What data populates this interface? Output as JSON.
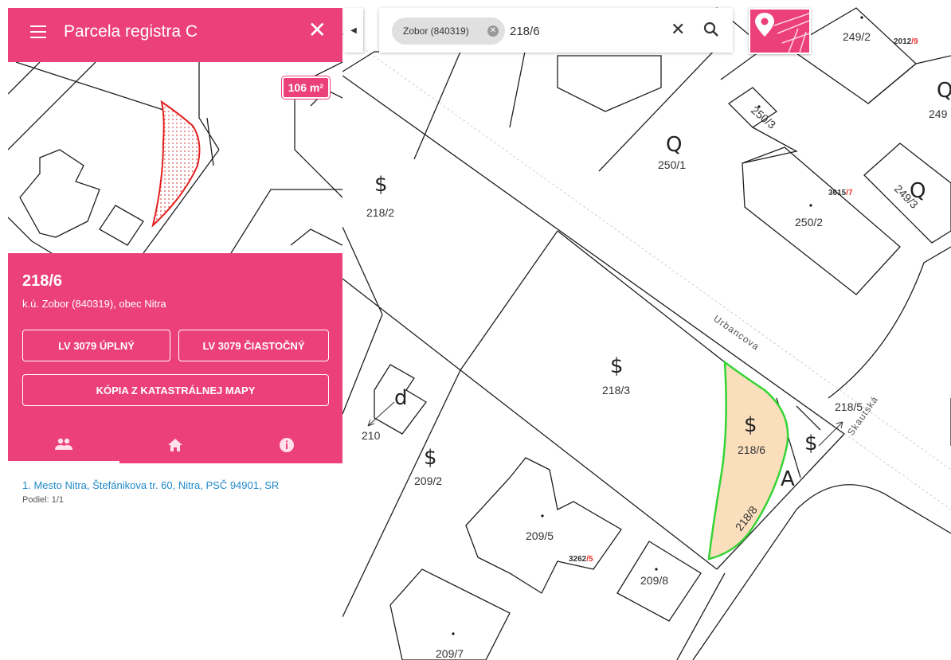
{
  "panel": {
    "title": "Parcela registra C",
    "area_badge": "106 m²",
    "parcel_number": "218/6",
    "location": "k.ú. Zobor (840319), obec Nitra",
    "buttons": {
      "lv_full": "LV 3079 ÚPLNÝ",
      "lv_partial": "LV 3079 ČIASTOČNÝ",
      "copy_map": "KÓPIA Z KATASTRÁLNEJ MAPY"
    },
    "tabs": [
      "owners-icon",
      "house-icon",
      "info-icon"
    ],
    "owner": "1. Mesto Nitra, Štefánikova tr. 60, Nitra, PSČ 94901, SR",
    "share": "Podiel: 1/1"
  },
  "search": {
    "chip_label": "Zobor (840319)",
    "query": "218/6"
  },
  "map": {
    "parcels": [
      "249/2",
      "249",
      "250/3",
      "250/1",
      "250/2",
      "249/3",
      "218/2",
      "218/3",
      "218/6",
      "218/8",
      "218/5",
      "209/2",
      "209/5",
      "209/8",
      "209/7",
      "210"
    ],
    "building_numbers": [
      {
        "num": "2012",
        "suffix": "/9"
      },
      {
        "num": "3615",
        "suffix": "/7"
      },
      {
        "num": "3262",
        "suffix": "/5"
      }
    ],
    "streets": [
      "Urbancova",
      "Skautská"
    ],
    "selected_fill": "#fbdfbd",
    "selected_stroke": "#35d435",
    "accent": "#ec407a"
  }
}
